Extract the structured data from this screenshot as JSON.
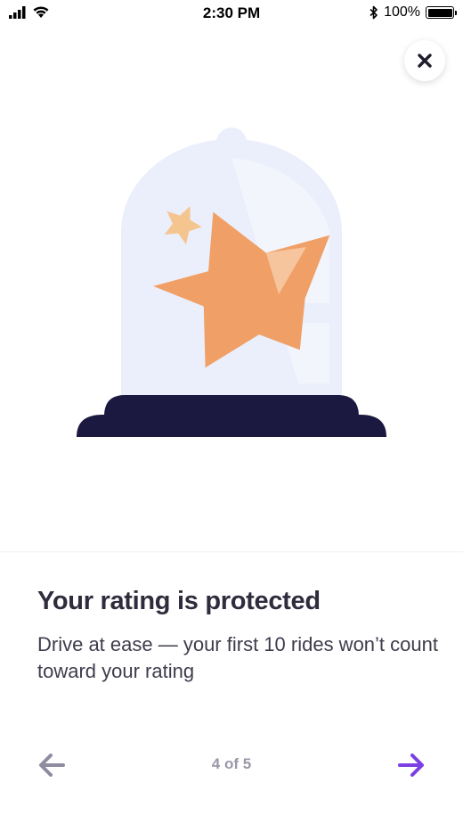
{
  "status_bar": {
    "time": "2:30 PM",
    "battery_text": "100%",
    "icons": [
      "signal-icon",
      "wifi-icon",
      "bluetooth-icon",
      "battery-icon"
    ]
  },
  "close_button": {
    "icon": "close-icon"
  },
  "illustration": {
    "subject": "star-under-glass-dome",
    "colors": {
      "dome": "#ebeefb",
      "star_large": "#f0a067",
      "star_small": "#f5c590",
      "base": "#1c1941"
    }
  },
  "content": {
    "title": "Your rating is protected",
    "description": "Drive at ease — your first 10 rides won’t count toward your rating"
  },
  "pager": {
    "text": "4 of 5",
    "back_icon": "arrow-left-icon",
    "next_icon": "arrow-right-icon",
    "colors": {
      "back": "#8f8ca0",
      "next": "#7b3fe4"
    }
  }
}
